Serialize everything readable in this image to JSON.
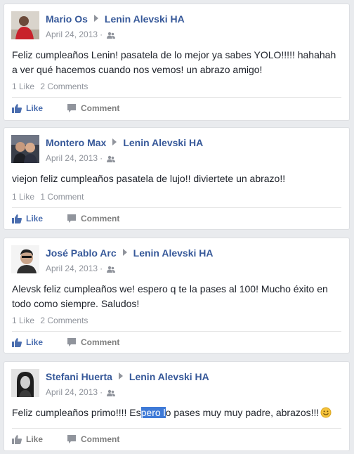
{
  "posts": [
    {
      "author": "Mario Os",
      "target": "Lenin Alevski HA",
      "date": "April 24, 2013",
      "text": "Feliz cumpleaños Lenin! pasatela de lo mejor ya sabes YOLO!!!!! hahahah a ver qué hacemos cuando nos vemos! un abrazo amigo!",
      "likes": "1 Like",
      "comments": "2 Comments",
      "like_label": "Like",
      "comment_label": "Comment"
    },
    {
      "author": "Montero Max",
      "target": "Lenin Alevski HA",
      "date": "April 24, 2013",
      "text": "viejon feliz cumpleaños pasatela de lujo!! diviertete un abrazo!!",
      "likes": "1 Like",
      "comments": "1 Comment",
      "like_label": "Like",
      "comment_label": "Comment"
    },
    {
      "author": "José Pablo Arc",
      "target": "Lenin Alevski HA",
      "date": "April 24, 2013",
      "text": "Alevsk feliz cumpleaños we! espero q te la pases al 100! Mucho éxito en todo como siempre. Saludos!",
      "likes": "1 Like",
      "comments": "2 Comments",
      "like_label": "Like",
      "comment_label": "Comment"
    },
    {
      "author": "Stefani Huerta",
      "target": "Lenin Alevski HA",
      "date": "April 24, 2013",
      "text_before": "Feliz cumpleaños primo!!!! Es",
      "text_selected": "pero l",
      "text_after": "o pases muy muy padre, abrazos!!!",
      "like_label": "Like",
      "comment_label": "Comment"
    }
  ],
  "colors": {
    "link": "#365899",
    "meta": "#90949c",
    "like_action": "#4b6eaf",
    "background": "#e9ebee",
    "selection": "#3e7ad7"
  },
  "icons": {
    "separator": "triangle-right-icon",
    "privacy": "friends-icon",
    "like": "thumbs-up-icon",
    "comment": "speech-bubble-icon",
    "emoji": "smiley-icon"
  }
}
